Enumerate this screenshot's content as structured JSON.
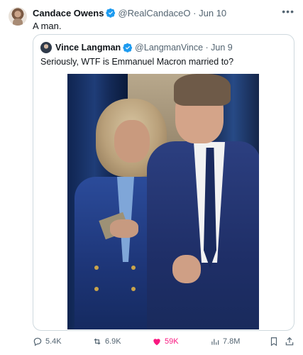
{
  "tweet": {
    "author_name": "Candace Owens",
    "handle": "@RealCandaceO",
    "separator": "·",
    "date": "Jun 10",
    "text": "A man.",
    "more_icon": "more-horizontal-icon",
    "verified_color": "#1d9bf0"
  },
  "quote": {
    "author_name": "Vince Langman",
    "handle": "@LangmanVince",
    "separator": "·",
    "date": "Jun 9",
    "text": "Seriously, WTF is Emmanuel Macron married to?"
  },
  "actions": {
    "replies": "5.4K",
    "reposts": "6.9K",
    "likes": "59K",
    "views": "7.8M",
    "like_color": "#f91880",
    "icons": [
      "reply-icon",
      "repost-icon",
      "like-icon",
      "views-icon",
      "bookmark-icon",
      "share-icon"
    ]
  }
}
